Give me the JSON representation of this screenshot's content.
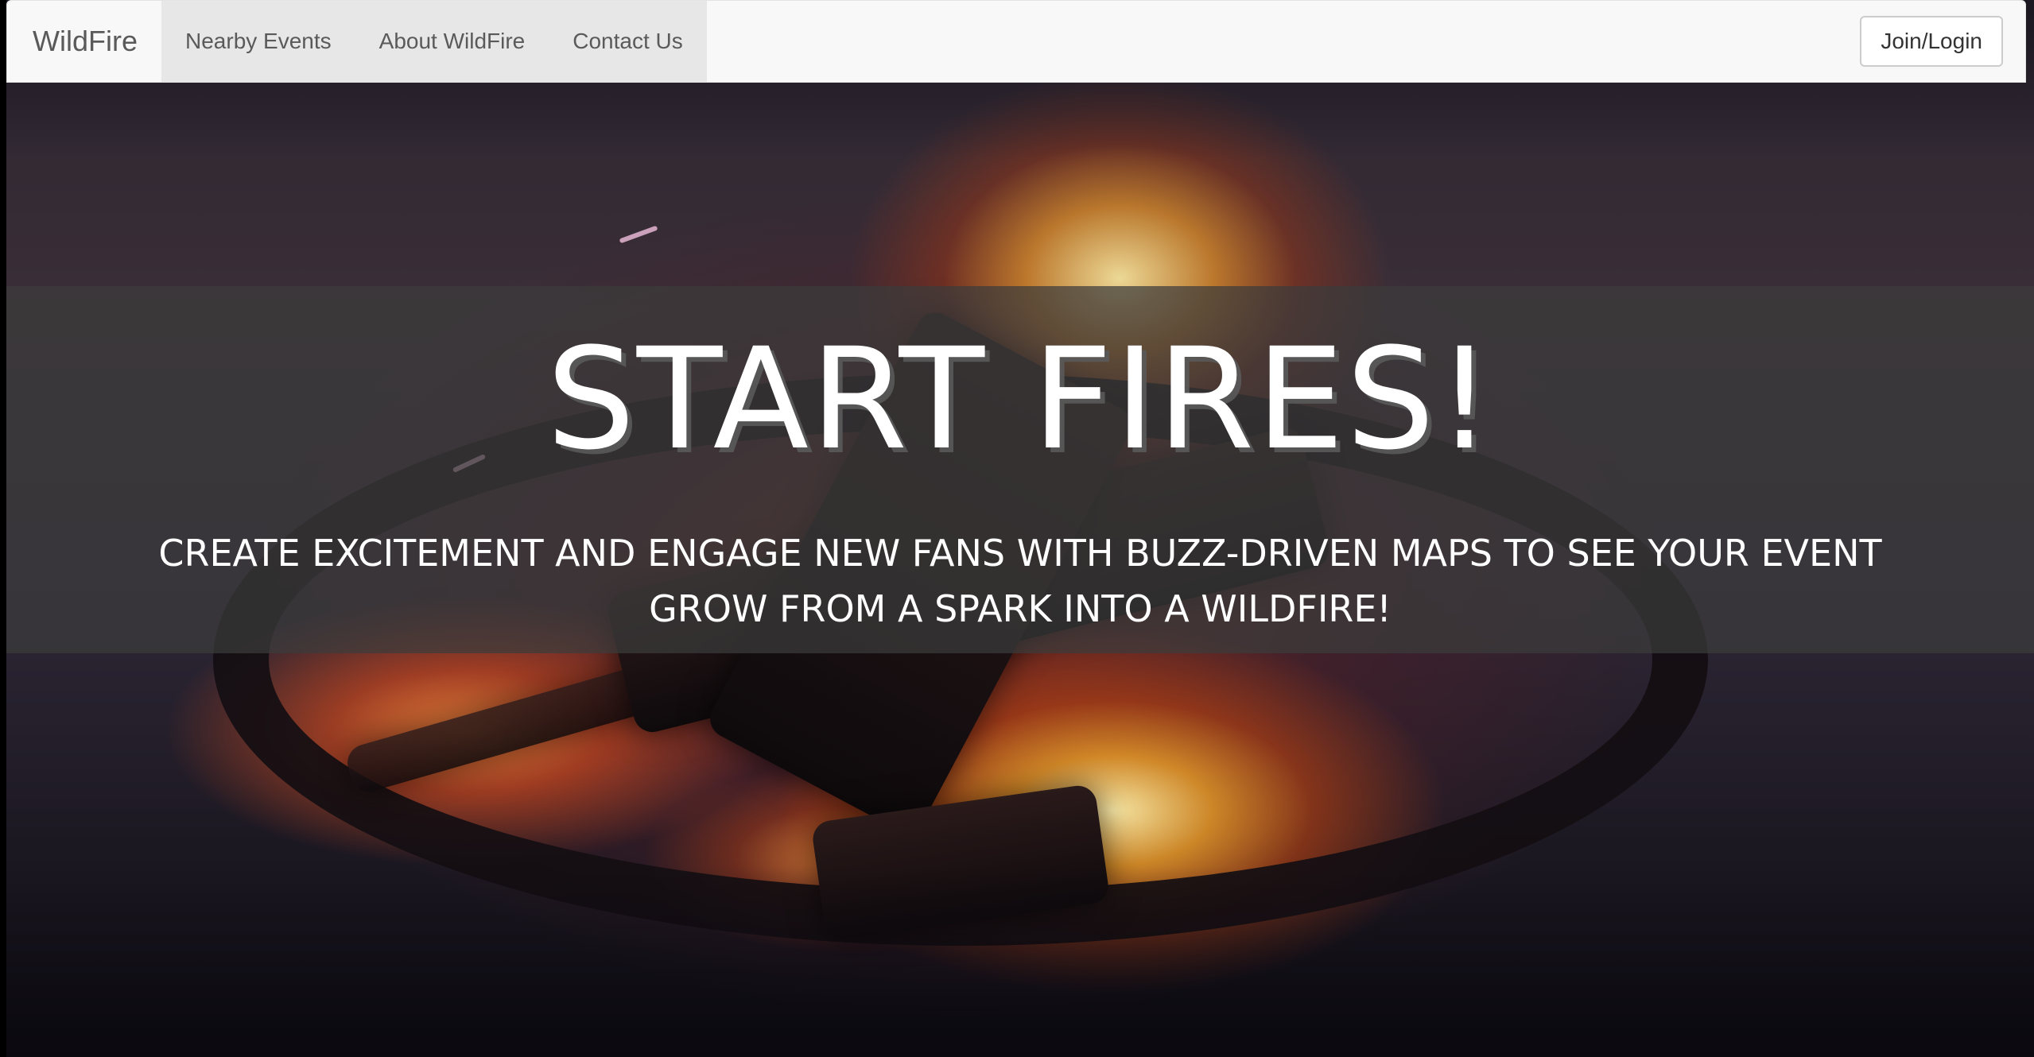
{
  "navbar": {
    "brand": "WildFire",
    "links": [
      {
        "label": "Nearby Events"
      },
      {
        "label": "About WildFire"
      },
      {
        "label": "Contact Us"
      }
    ],
    "login_label": "Join/Login"
  },
  "hero": {
    "title": "START FIRES!",
    "subtitle": "CREATE EXCITEMENT AND ENGAGE NEW FANS WITH BUZZ-DRIVEN MAPS TO SEE YOUR EVENT GROW FROM A SPARK INTO A WILDFIRE!"
  },
  "colors": {
    "navbar_bg": "#f8f8f8",
    "nav_active_bg": "#e7e7e7",
    "nav_text": "#5a5a5a",
    "hero_band": "rgba(60,60,60,0.72)",
    "hero_text": "#ffffff"
  }
}
